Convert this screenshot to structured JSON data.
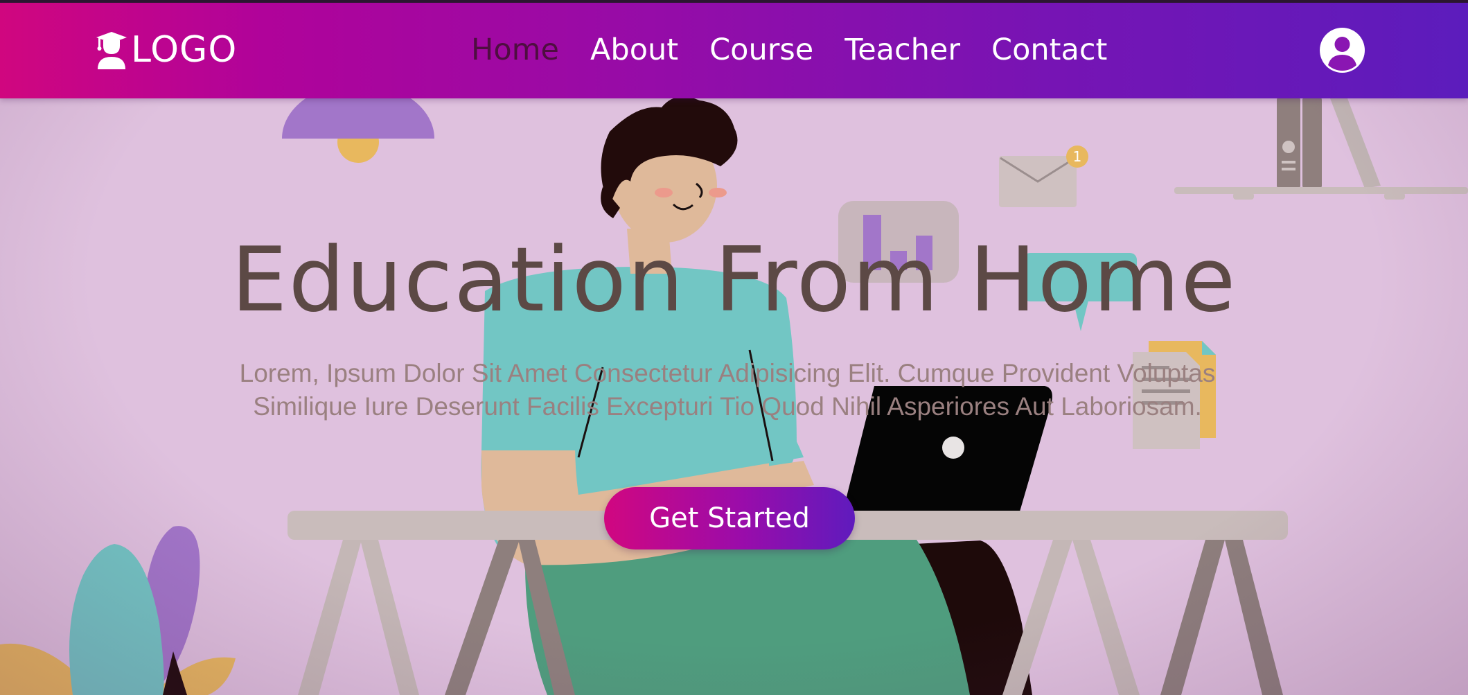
{
  "brand": {
    "logo_text": "LOGO",
    "logo_icon": "graduate-student-icon"
  },
  "nav": {
    "items": [
      {
        "label": "Home",
        "active": true
      },
      {
        "label": "About",
        "active": false
      },
      {
        "label": "Course",
        "active": false
      },
      {
        "label": "Teacher",
        "active": false
      },
      {
        "label": "Contact",
        "active": false
      }
    ],
    "user_icon": "user-circle-icon"
  },
  "hero": {
    "title": "Education From Home",
    "description": "Lorem, Ipsum Dolor Sit Amet Consectetur Adipisicing Elit. Cumque Provident Voluptas Similique Iure Deserunt Facilis Excepturi Tio Quod Nihil Asperiores Aut Laboriosam.",
    "cta_label": "Get Started"
  },
  "illustration": {
    "mail_badge_count": "1"
  },
  "colors": {
    "nav_gradient_start": "#d0067f",
    "nav_gradient_end": "#5c1cbc",
    "active_nav": "#4e0e40",
    "background": "#dfc1de",
    "title_text": "#5c4945"
  }
}
